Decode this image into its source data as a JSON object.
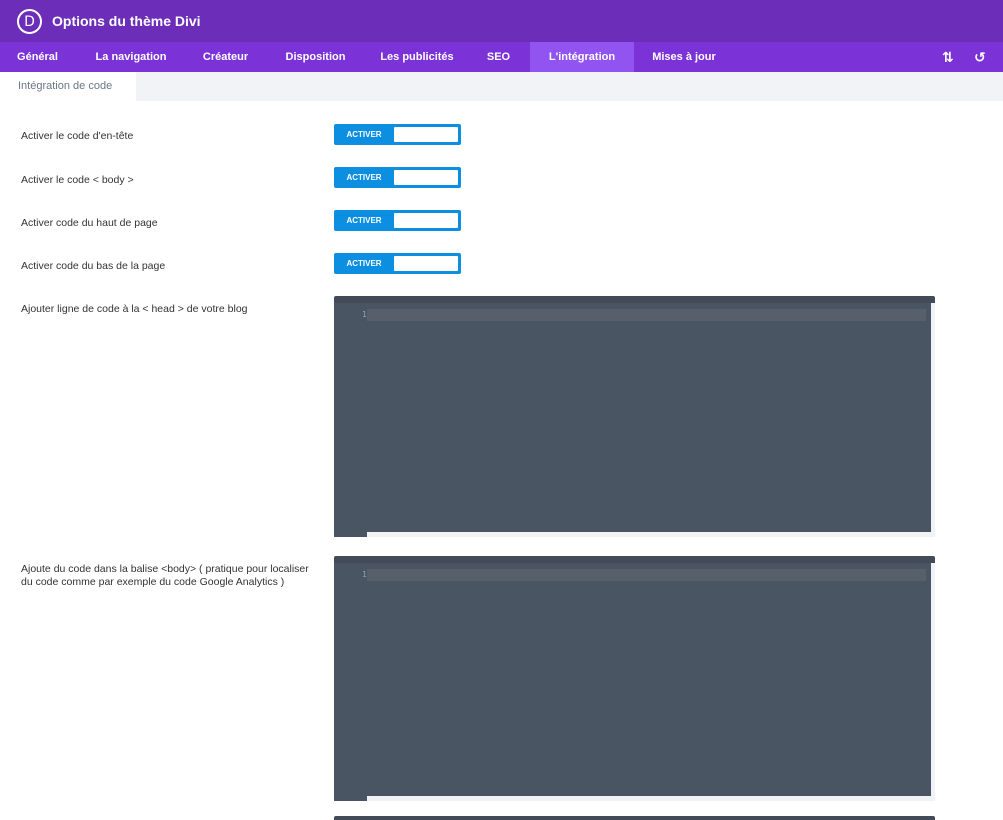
{
  "app": {
    "logo_letter": "D",
    "title": "Options du thème Divi"
  },
  "tabs": [
    {
      "label": "Général"
    },
    {
      "label": "La navigation"
    },
    {
      "label": "Créateur"
    },
    {
      "label": "Disposition"
    },
    {
      "label": "Les publicités"
    },
    {
      "label": "SEO"
    },
    {
      "label": "L'intégration",
      "active": true
    },
    {
      "label": "Mises à jour"
    }
  ],
  "tab_tools": {
    "sort_icon": "⇅",
    "reset_icon": "↺"
  },
  "subtab": {
    "label": "Intégration de code"
  },
  "settings": [
    {
      "label": "Activer le code d'en-tête",
      "toggle": "ACTIVER"
    },
    {
      "label": "Activer le code < body >",
      "toggle": "ACTIVER"
    },
    {
      "label": "Activer code du haut de page",
      "toggle": "ACTIVER"
    },
    {
      "label": "Activer code du bas de la page",
      "toggle": "ACTIVER"
    }
  ],
  "editors": [
    {
      "label": "Ajouter ligne de code à la < head > de votre blog",
      "line": "1"
    },
    {
      "label": "Ajoute du code dans la balise <body> ( pratique pour localiser du code comme par exemple du code Google Analytics )",
      "line": "1"
    }
  ],
  "colors": {
    "header": "#6c2eb9",
    "tabbar": "#7b33d8",
    "tab_active": "#9254f0",
    "toggle": "#0c8fe1",
    "editor_bg": "#4a5563"
  }
}
